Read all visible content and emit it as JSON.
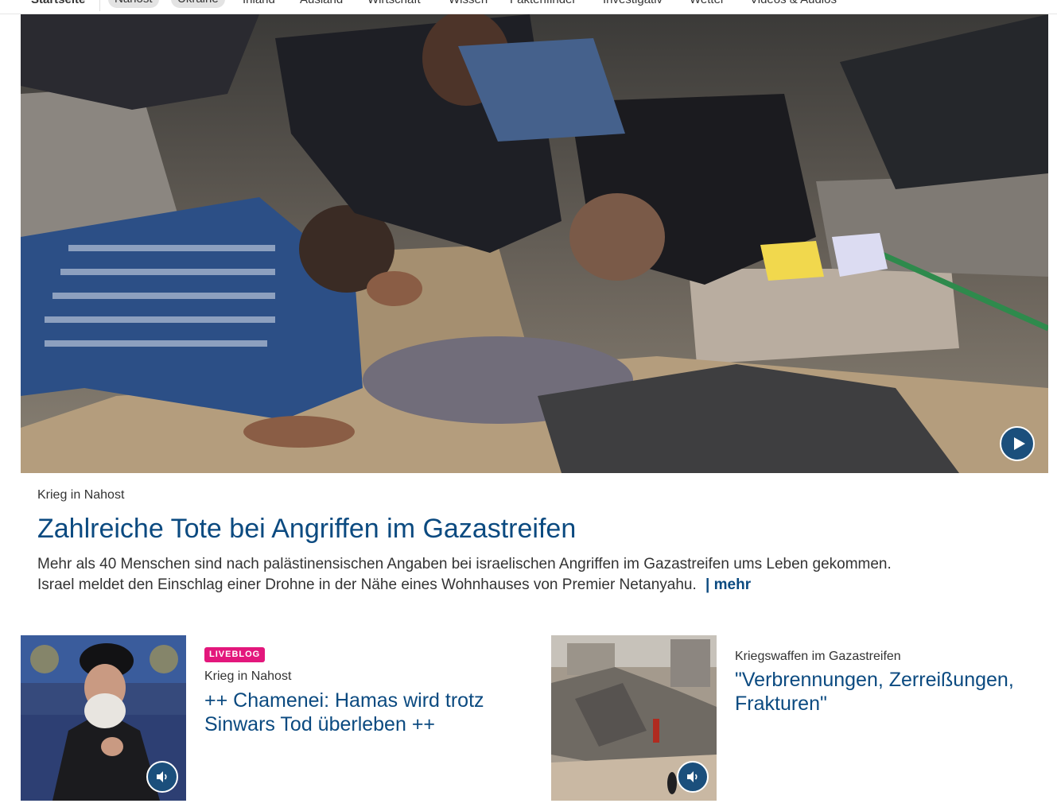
{
  "nav": {
    "items": [
      "Startseite",
      "Nahost",
      "Ukraine",
      "Inland",
      "Ausland",
      "Wirtschaft",
      "Wissen",
      "Faktenfinder",
      "Investigativ",
      "Wetter",
      "Videos & Audios"
    ]
  },
  "hero": {
    "image_alt": "Rescue workers search rubble in Gaza",
    "play_icon": "play-icon",
    "kicker": "Krieg in Nahost",
    "title": "Zahlreiche Tote bei Angriffen im Gazastreifen",
    "teaser": "Mehr als 40 Menschen sind nach palästinensischen Angaben bei israelischen Angriffen im Gazastreifen ums Leben gekommen. Israel meldet den Einschlag einer Drohne in der Nähe eines Wohnhauses von Premier Netanyahu.",
    "more_label": "| mehr"
  },
  "teasers": [
    {
      "badge": "LIVEBLOG",
      "kicker": "Krieg in Nahost",
      "title": "++ Chamenei: Hamas wird trotz Sinwars Tod überleben ++",
      "audio_icon": "speaker-icon"
    },
    {
      "kicker": "Kriegswaffen im Gazastreifen",
      "title": "\"Verbrennungen, Zerreißungen, Frakturen\"",
      "audio_icon": "speaker-icon"
    }
  ],
  "colors": {
    "link_blue": "#0b4a80",
    "button_blue": "#1b4f7c",
    "liveblog_pink": "#e3177c"
  }
}
